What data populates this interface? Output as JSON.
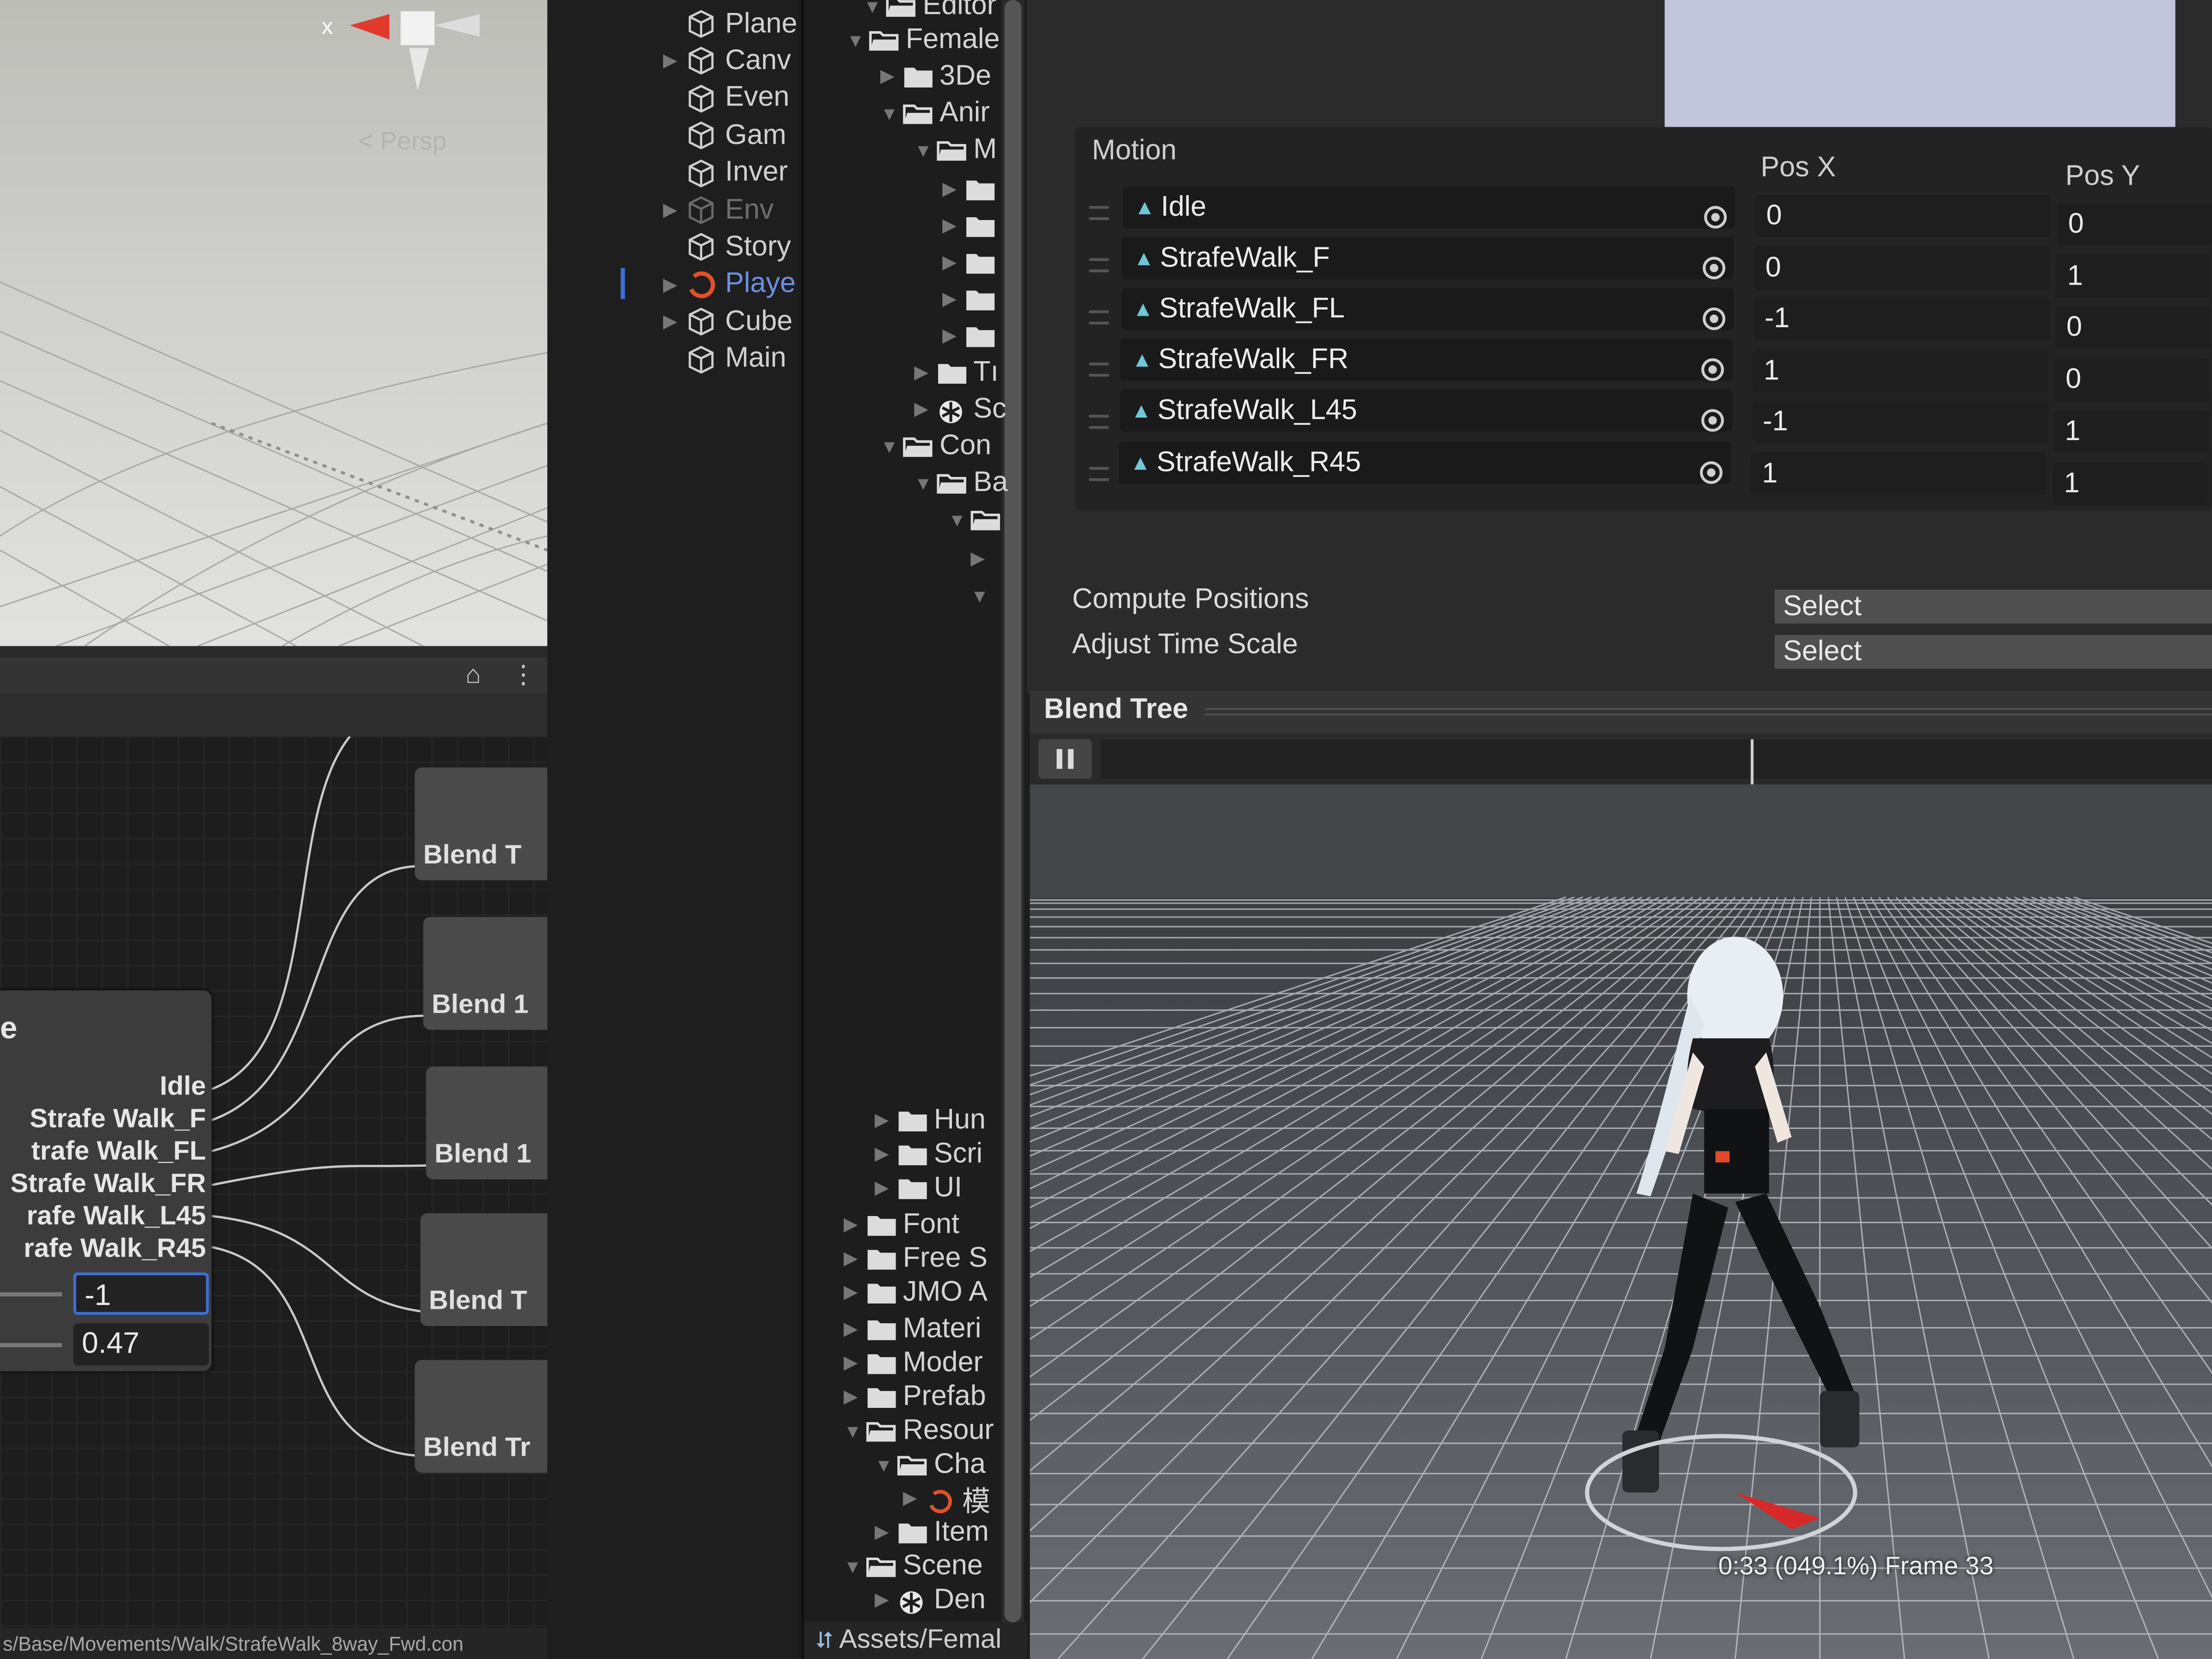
{
  "scene_view": {
    "axis_x": "x",
    "persp_label": "< Persp"
  },
  "graph": {
    "node_title_fragment": "e",
    "node_outputs": [
      "Idle",
      "Strafe Walk_F",
      "trafe Walk_FL",
      "Strafe Walk_FR",
      "rafe Walk_L45",
      "rafe Walk_R45"
    ],
    "param_x": "-1",
    "param_y": "0.47",
    "blend_nodes": [
      "Blend T",
      "Blend 1",
      "Blend 1",
      "Blend T",
      "Blend Tr"
    ],
    "path": "s/Base/Movements/Walk/StrafeWalk_8way_Fwd.con"
  },
  "hierarchy": {
    "items": [
      {
        "label": "Plane",
        "expand": false
      },
      {
        "label": "Canv",
        "expand": true
      },
      {
        "label": "Even",
        "expand": false
      },
      {
        "label": "Gam",
        "expand": false
      },
      {
        "label": "Inver",
        "expand": false
      },
      {
        "label": "Env",
        "expand": true,
        "disabled": true
      },
      {
        "label": "Story",
        "expand": false
      },
      {
        "label": "Playe",
        "expand": true,
        "highlight": true
      },
      {
        "label": "Cube",
        "expand": true
      },
      {
        "label": "Main",
        "expand": false
      }
    ]
  },
  "project": {
    "top_items": [
      "Editor",
      "Female",
      "3De",
      "Anir",
      "M",
      "",
      "",
      "",
      "",
      "",
      "Tı",
      "Sc",
      "Con",
      "Ba",
      ""
    ],
    "bottom_items": [
      "Hun",
      "Scri",
      "UI",
      "Font",
      "Free S",
      "JMO A",
      "Materi",
      "Moder",
      "Prefab",
      "Resour",
      "Cha",
      "模",
      "Item",
      "Scene",
      "Den"
    ],
    "footer": "Assets/Femal"
  },
  "inspector": {
    "motion_header": "Motion",
    "posx_header": "Pos X",
    "posy_header": "Pos Y",
    "motions": [
      {
        "name": "Idle",
        "pos_x": "0",
        "pos_y": "0"
      },
      {
        "name": "StrafeWalk_F",
        "pos_x": "0",
        "pos_y": "1"
      },
      {
        "name": "StrafeWalk_FL",
        "pos_x": "-1",
        "pos_y": "0"
      },
      {
        "name": "StrafeWalk_FR",
        "pos_x": "1",
        "pos_y": "0"
      },
      {
        "name": "StrafeWalk_L45",
        "pos_x": "-1",
        "pos_y": "1"
      },
      {
        "name": "StrafeWalk_R45",
        "pos_x": "1",
        "pos_y": "1"
      }
    ],
    "compute_positions_label": "Compute Positions",
    "compute_positions_value": "Select",
    "adjust_time_scale_label": "Adjust Time Scale",
    "adjust_time_scale_value": "Select"
  },
  "blend_tree": {
    "title": "Blend Tree",
    "play_state": "pause",
    "progress": 0.491,
    "status": "0:33 (049.1%) Frame 33"
  },
  "colors": {
    "accent_blue": "#3d6fd6",
    "player_orange": "#e0502a",
    "playe_text": "#6d8fe0",
    "clip_icon": "#6fc7d9"
  }
}
